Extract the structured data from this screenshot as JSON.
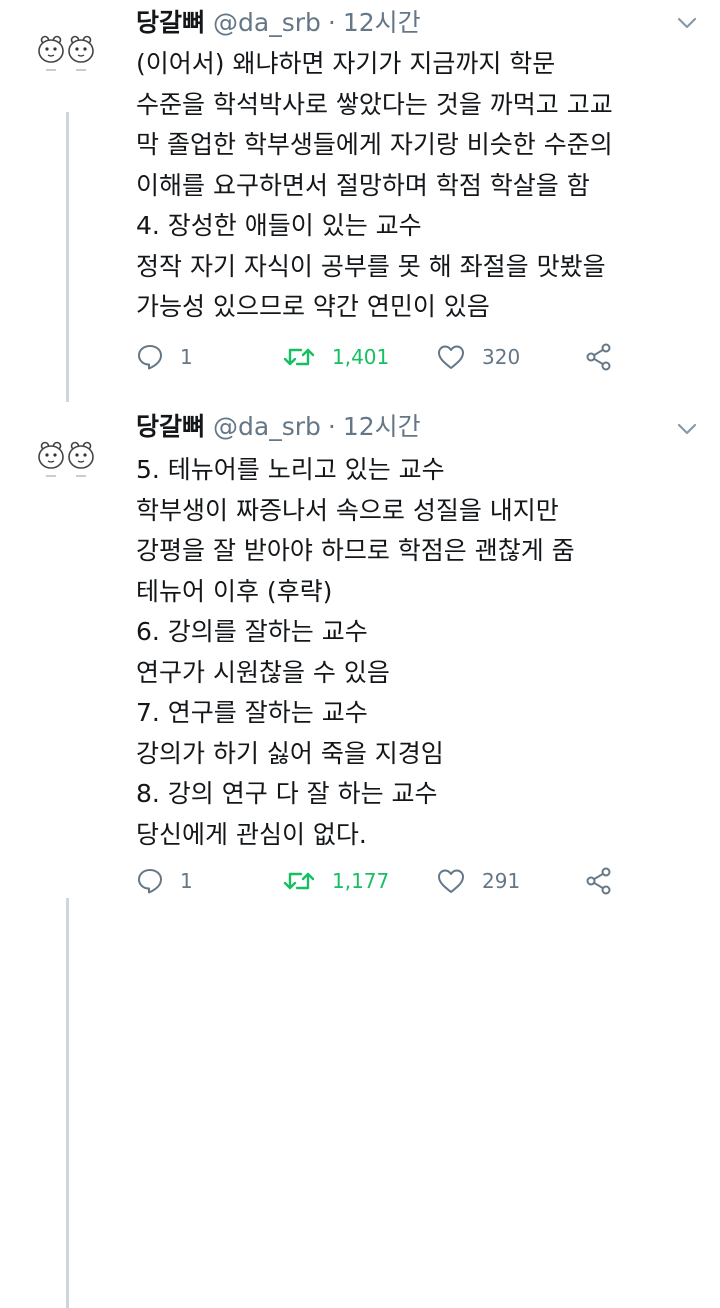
{
  "colors": {
    "text": "#14171a",
    "secondary": "#657786",
    "retweet_active": "#17bf63",
    "thread_line": "#ccd6dd"
  },
  "icons": {
    "avatar": "hamster-avatar-icon",
    "caret": "chevron-down-icon",
    "reply": "reply-bubble-icon",
    "retweet": "retweet-arrows-icon",
    "like": "heart-icon",
    "share": "share-icon"
  },
  "tweets": [
    {
      "name": "당갈뼈",
      "handle": "@da_srb",
      "separator": "·",
      "time": "12시간",
      "lines": [
        "(이어서) 왜냐하면 자기가 지금까지 학문",
        "수준을 학석박사로 쌓았다는 것을 까먹고 고교",
        "막 졸업한 학부생들에게 자기랑 비슷한 수준의",
        "이해를 요구하면서 절망하며 학점 학살을 함",
        "4. 장성한 애들이 있는 교수",
        "정작 자기 자식이 공부를 못 해 좌절을 맛봤을",
        "가능성 있으므로 약간 연민이 있음"
      ],
      "replies": "1",
      "retweets": "1,401",
      "likes": "320"
    },
    {
      "name": "당갈뼈",
      "handle": "@da_srb",
      "separator": "·",
      "time": "12시간",
      "lines": [
        "5. 테뉴어를 노리고 있는 교수",
        "학부생이 짜증나서 속으로 성질을 내지만",
        "강평을 잘 받아야 하므로 학점은 괜찮게 줌",
        "테뉴어 이후 (후략)",
        "6. 강의를 잘하는 교수",
        "연구가 시원찮을 수 있음",
        "7. 연구를 잘하는 교수",
        "강의가 하기 싫어 죽을 지경임",
        "8. 강의 연구 다 잘 하는 교수",
        "당신에게 관심이 없다."
      ],
      "replies": "1",
      "retweets": "1,177",
      "likes": "291"
    }
  ]
}
